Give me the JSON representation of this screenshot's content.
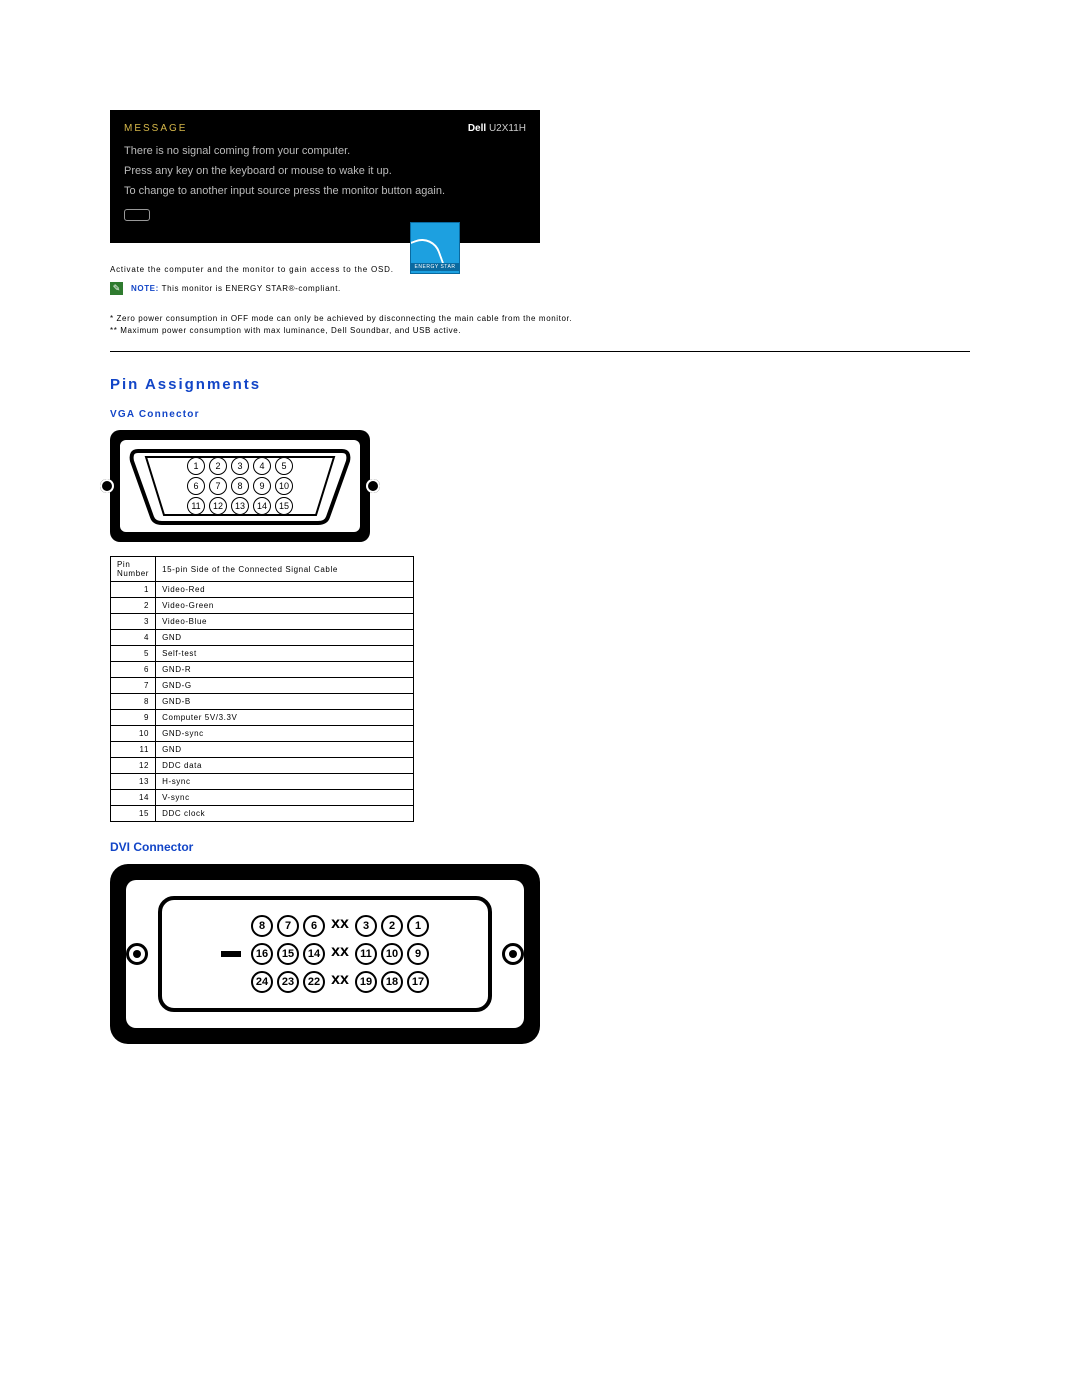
{
  "osd": {
    "message_label": "MESSAGE",
    "brand": "Dell",
    "model": "U2X11H",
    "line1": "There is no signal coming from your computer.",
    "line2": "Press any key on the keyboard or mouse to wake it up.",
    "line3": "To change to another input source press the monitor button again."
  },
  "caption_osd": "Activate the computer and the monitor to gain access to the OSD.",
  "note": {
    "prefix": "NOTE:",
    "text": "This monitor is ENERGY STAR®-compliant."
  },
  "energy_star_label": "ENERGY STAR",
  "footnote1": "*   Zero power consumption in OFF mode can only be achieved by disconnecting the main cable from the monitor.",
  "footnote2": "** Maximum power consumption with max luminance, Dell Soundbar, and USB active.",
  "section_title": "Pin Assignments",
  "vga_title": "VGA Connector",
  "dvi_title": "DVI Connector",
  "vga_pins_rows": [
    [
      "1",
      "2",
      "3",
      "4",
      "5"
    ],
    [
      "6",
      "7",
      "8",
      "9",
      "10"
    ],
    [
      "11",
      "12",
      "13",
      "14",
      "15"
    ]
  ],
  "pin_table": {
    "header_left": "Pin Number",
    "header_right": "15-pin Side of the Connected Signal Cable",
    "rows": [
      {
        "n": "1",
        "v": "Video-Red"
      },
      {
        "n": "2",
        "v": "Video-Green"
      },
      {
        "n": "3",
        "v": "Video-Blue"
      },
      {
        "n": "4",
        "v": "GND"
      },
      {
        "n": "5",
        "v": "Self-test"
      },
      {
        "n": "6",
        "v": "GND-R"
      },
      {
        "n": "7",
        "v": "GND-G"
      },
      {
        "n": "8",
        "v": "GND-B"
      },
      {
        "n": "9",
        "v": "Computer 5V/3.3V"
      },
      {
        "n": "10",
        "v": "GND-sync"
      },
      {
        "n": "11",
        "v": "GND"
      },
      {
        "n": "12",
        "v": "DDC data"
      },
      {
        "n": "13",
        "v": "H-sync"
      },
      {
        "n": "14",
        "v": "V-sync"
      },
      {
        "n": "15",
        "v": "DDC clock"
      }
    ]
  },
  "dvi_rows": [
    {
      "left": [
        "8",
        "7",
        "6"
      ],
      "right": [
        "3",
        "2",
        "1"
      ]
    },
    {
      "left": [
        "16",
        "15",
        "14"
      ],
      "right": [
        "11",
        "10",
        "9"
      ]
    },
    {
      "left": [
        "24",
        "23",
        "22"
      ],
      "right": [
        "19",
        "18",
        "17"
      ]
    }
  ],
  "dvi_xx": "xx"
}
